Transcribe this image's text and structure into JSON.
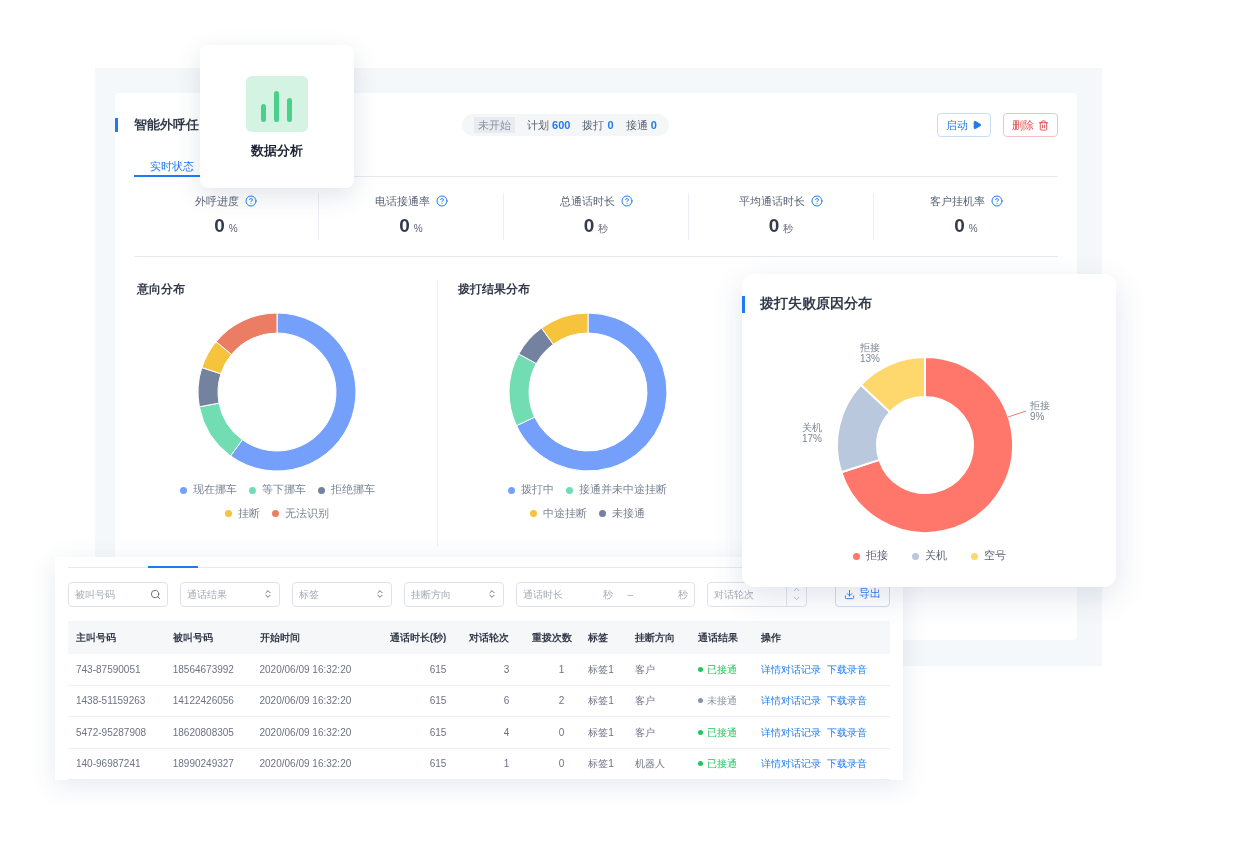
{
  "feature_card": {
    "title": "数据分析"
  },
  "task": {
    "title": "智能外呼任",
    "status": "未开始",
    "counts": [
      {
        "label": "计划",
        "value": "600"
      },
      {
        "label": "拨打",
        "value": "0"
      },
      {
        "label": "接通",
        "value": "0"
      }
    ],
    "buttons": [
      {
        "kind": "start",
        "label": "启动"
      },
      {
        "kind": "delete",
        "label": "删除"
      }
    ]
  },
  "tabs": [
    {
      "label": "实时状态",
      "selected": true
    }
  ],
  "stats": [
    {
      "label": "外呼进度",
      "value": "0",
      "unit": "%"
    },
    {
      "label": "电话接通率",
      "value": "0",
      "unit": "%"
    },
    {
      "label": "总通话时长",
      "value": "0",
      "unit": "秒"
    },
    {
      "label": "平均通话时长",
      "value": "0",
      "unit": "秒"
    },
    {
      "label": "客户挂机率",
      "value": "0",
      "unit": "%"
    }
  ],
  "charts": [
    {
      "title": "意向分布",
      "legend": [
        {
          "label": "现在挪车",
          "color": "#74a0fb"
        },
        {
          "label": "等下挪车",
          "color": "#72dcb2"
        },
        {
          "label": "拒绝挪车",
          "color": "#73829f"
        },
        {
          "label": "挂断",
          "color": "#f6c43c"
        },
        {
          "label": "无法识别",
          "color": "#ec7d65"
        }
      ]
    },
    {
      "title": "拨打结果分布",
      "legend": [
        {
          "label": "拨打中",
          "color": "#74a0fb"
        },
        {
          "label": "接通并未中途挂断",
          "color": "#72dcb2"
        },
        {
          "label": "中途挂断",
          "color": "#f6c43c"
        },
        {
          "label": "未接通",
          "color": "#73829f"
        }
      ]
    }
  ],
  "failure_chart": {
    "title": "拨打失败原因分布",
    "callouts": [
      {
        "label": "拒接",
        "percent": "13%"
      },
      {
        "label": "关机",
        "percent": "17%"
      },
      {
        "label": "拒接",
        "percent": "9%"
      }
    ],
    "legend": [
      {
        "label": "拒接",
        "color": "#ff766a"
      },
      {
        "label": "关机",
        "color": "#b9c8dd"
      },
      {
        "label": "空号",
        "color": "#fed86c"
      }
    ]
  },
  "filters": [
    {
      "kind": "search",
      "placeholder": "被叫号码"
    },
    {
      "kind": "select",
      "placeholder": "通话结果"
    },
    {
      "kind": "select",
      "placeholder": "标签"
    },
    {
      "kind": "select",
      "placeholder": "挂断方向"
    },
    {
      "kind": "range",
      "placeholder": "通话时长",
      "unit": "秒",
      "separator": "–",
      "unit_end": "秒"
    },
    {
      "kind": "number",
      "placeholder": "对话轮次"
    }
  ],
  "export_button": "导出",
  "table": {
    "columns": [
      "主叫号码",
      "被叫号码",
      "开始时间",
      "通话时长(秒)",
      "对话轮次",
      "重拨次数",
      "标签",
      "挂断方向",
      "通话结果",
      "操作"
    ],
    "rows": [
      {
        "caller": "743-87590051",
        "callee": "18564673992",
        "start": "2020/06/09 16:32:20",
        "duration": "615",
        "rounds": "3",
        "redials": "1",
        "tag": "标签1",
        "direction": "客户",
        "result": "已接通",
        "color": "#22c55e",
        "actions": [
          "详情对话记录",
          "下载录音"
        ]
      },
      {
        "caller": "1438-51159263",
        "callee": "14122426056",
        "start": "2020/06/09 16:32:20",
        "duration": "615",
        "rounds": "6",
        "redials": "2",
        "tag": "标签1",
        "direction": "客户",
        "result": "未接通",
        "color": "#8a94a6",
        "actions": [
          "详情对话记录",
          "下载录音"
        ]
      },
      {
        "caller": "5472-95287908",
        "callee": "18620808305",
        "start": "2020/06/09 16:32:20",
        "duration": "615",
        "rounds": "4",
        "redials": "0",
        "tag": "标签1",
        "direction": "客户",
        "result": "已接通",
        "color": "#22c55e",
        "actions": [
          "详情对话记录",
          "下载录音"
        ]
      },
      {
        "caller": "140-96987241",
        "callee": "18990249327",
        "start": "2020/06/09 16:32:20",
        "duration": "615",
        "rounds": "1",
        "redials": "0",
        "tag": "标签1",
        "direction": "机器人",
        "result": "已接通",
        "color": "#22c55e",
        "actions": [
          "详情对话记录",
          "下载录音"
        ]
      }
    ]
  }
}
